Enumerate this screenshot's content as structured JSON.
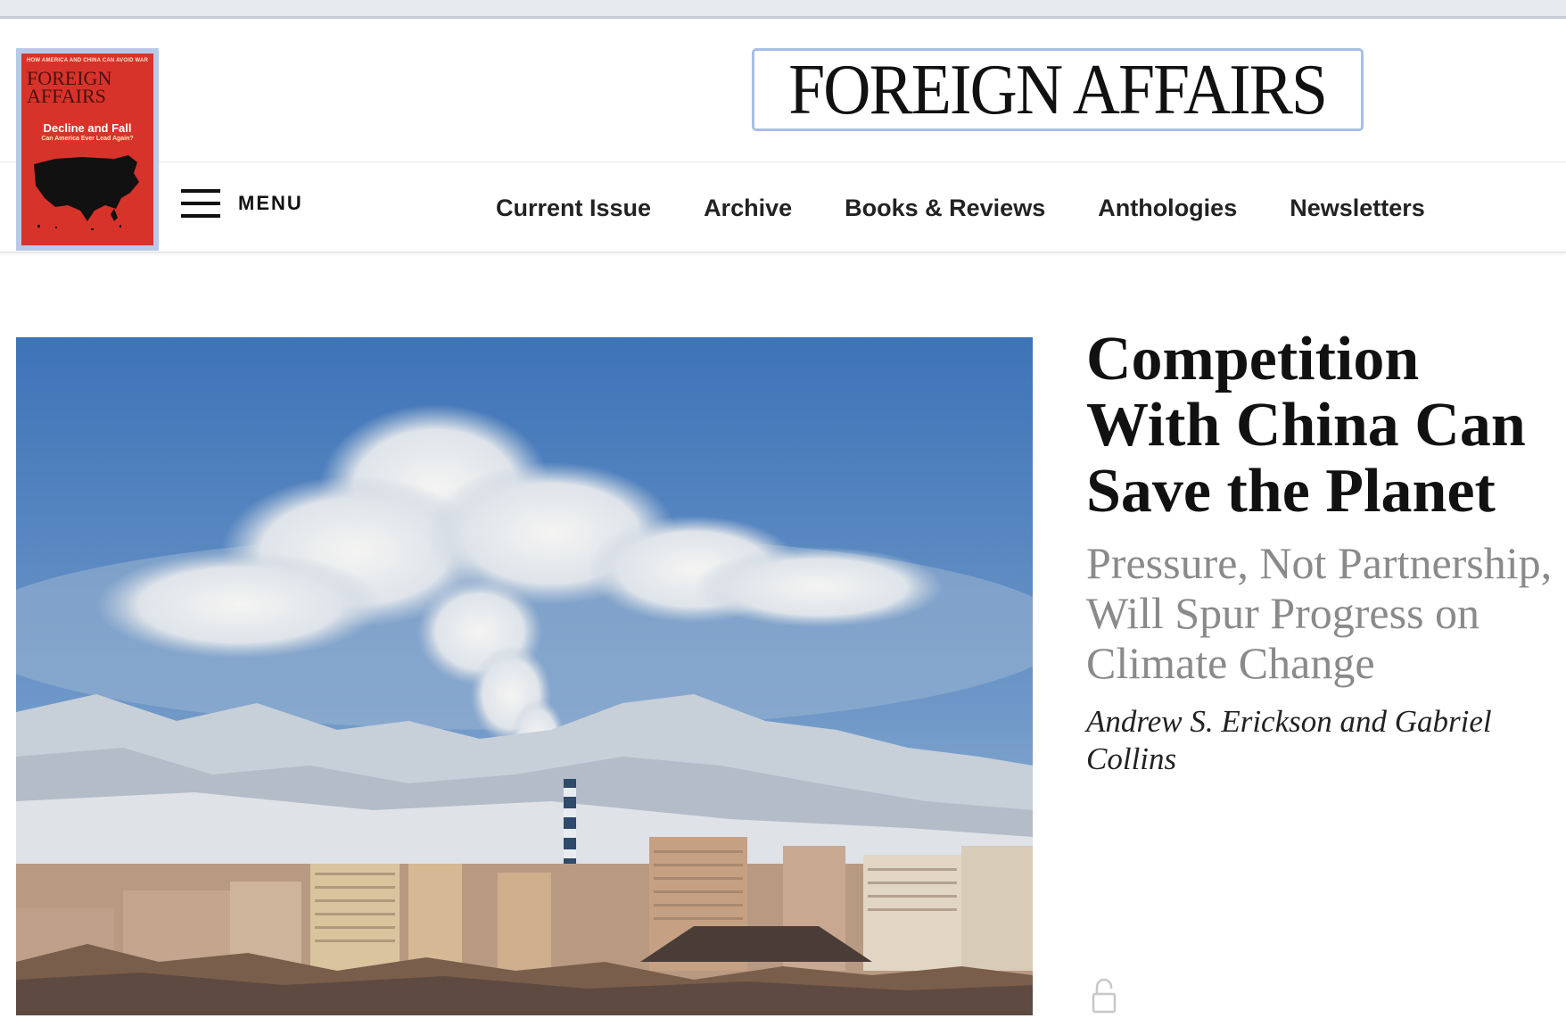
{
  "cover": {
    "topline": "HOW AMERICA AND CHINA CAN AVOID WAR",
    "masthead_line1": "FOREIGN",
    "masthead_line2": "AFFAIRS",
    "title": "Decline and Fall",
    "subtitle": "Can America Ever Lead Again?"
  },
  "logo": {
    "text": "FOREIGN AFFAIRS"
  },
  "menu": {
    "label": "MENU",
    "icon": "hamburger-icon"
  },
  "nav": {
    "items": [
      {
        "label": "Current Issue"
      },
      {
        "label": "Archive"
      },
      {
        "label": "Books & Reviews"
      },
      {
        "label": "Anthologies"
      },
      {
        "label": "Newsletters"
      }
    ]
  },
  "article": {
    "headline": "Competition With China Can Save the Planet",
    "dek": "Pressure, Not Partnership, Will Spur Progress on Climate Change",
    "byline": "Andrew S. Erickson and Gabriel Collins",
    "access_icon": "unlocked-padlock-icon"
  },
  "colors": {
    "cover_red": "#d8332a",
    "logo_border": "#a9bde9",
    "dek_gray": "#8a8a8a"
  }
}
